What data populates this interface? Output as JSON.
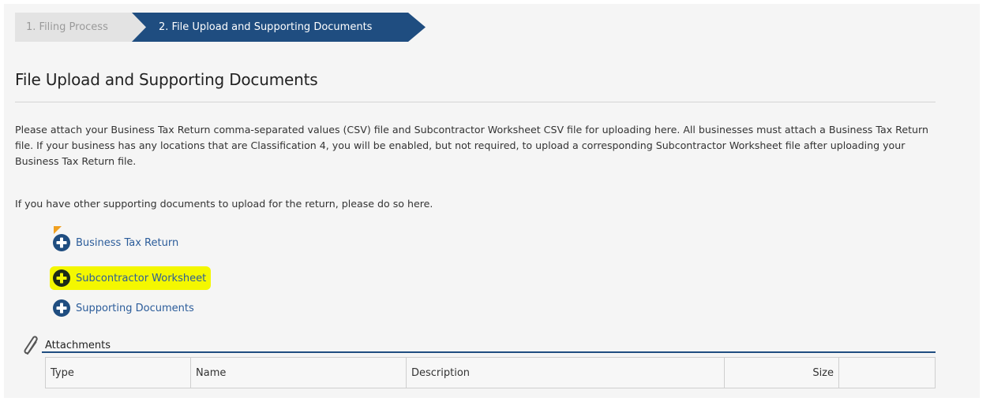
{
  "wizard": {
    "steps": [
      {
        "label": "1. Filing Process",
        "state": "inactive"
      },
      {
        "label": "2. File Upload and Supporting Documents",
        "state": "active"
      }
    ]
  },
  "page": {
    "title": "File Upload and Supporting Documents",
    "intro": "Please attach your Business Tax Return comma-separated values (CSV) file and Subcontractor Worksheet CSV file for uploading here. All businesses must attach a Business Tax Return file. If your business has any locations that are Classification 4, you will be enabled, but not required, to upload a corresponding Subcontractor Worksheet file after uploading your Business Tax Return file.",
    "supporting_note": "If you have other supporting documents to upload for the return, please do so here."
  },
  "uploads": {
    "items": [
      {
        "label": "Business Tax Return",
        "icon": "plus-circle-icon",
        "highlighted": false
      },
      {
        "label": "Subcontractor Worksheet",
        "icon": "plus-circle-icon",
        "highlighted": true
      },
      {
        "label": "Supporting Documents",
        "icon": "plus-circle-icon",
        "highlighted": false
      }
    ]
  },
  "attachments": {
    "title": "Attachments",
    "icon": "paperclip-icon",
    "columns": [
      "Type",
      "Name",
      "Description",
      "Size",
      ""
    ],
    "rows": []
  },
  "colors": {
    "brand": "#1f4d80",
    "link": "#2b5c9a",
    "highlight": "#f4f700",
    "background": "#f5f5f5"
  }
}
